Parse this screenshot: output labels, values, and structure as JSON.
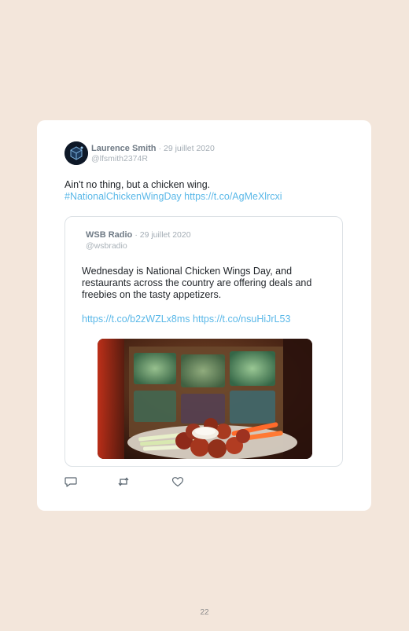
{
  "tweet": {
    "author_name": "Laurence Smith",
    "date": "· 29 juillet 2020",
    "handle": "@lfsmith2374R",
    "text": "Ain't no thing, but a chicken wing.",
    "hashtag": "#NationalChickenWingDay",
    "link": "https://t.co/AgMeXlrcxi"
  },
  "quoted_tweet": {
    "author_name": "WSB Radio",
    "date": "· 29 juillet 2020",
    "handle": "@wsbradio",
    "text": "Wednesday is National Chicken Wings Day, and restaurants across the country are offering deals and freebies on the tasty appetizers.",
    "link1": "https://t.co/b2zWZLx8ms",
    "link2": "https://t.co/nsuHiJrL53",
    "image": "chicken-wings-platter"
  },
  "actions": {
    "icons": [
      "reply-icon",
      "retweet-icon",
      "like-icon"
    ]
  },
  "footer": {
    "page_number": "22"
  },
  "colors": {
    "background": "#f3e6db",
    "card": "#ffffff",
    "link": "#5ab8e8",
    "text": "#1f2328",
    "muted": "#a9b1b8"
  }
}
